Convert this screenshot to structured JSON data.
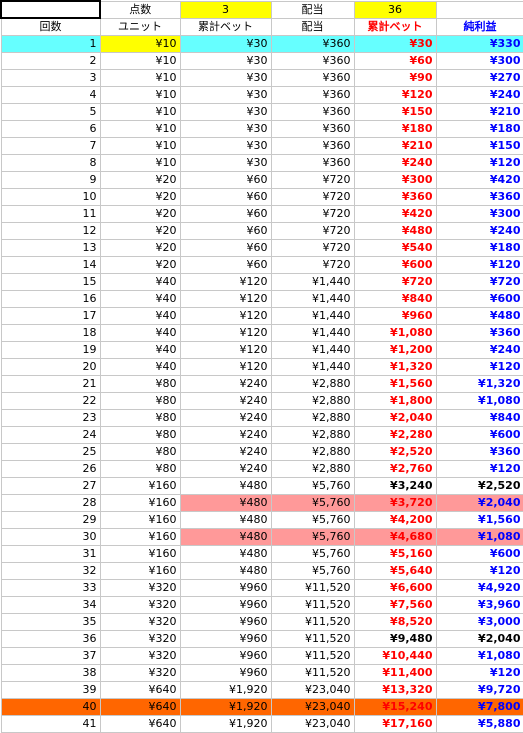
{
  "top": {
    "label_points": "点数",
    "points": "3",
    "label_payout": "配当",
    "payout": "36"
  },
  "headers": [
    "回数",
    "ユニット",
    "累計ベット",
    "配当",
    "累計ベット",
    "純利益"
  ],
  "colors": {
    "yellow": "#ffff00",
    "cyan": "#66ffff",
    "pink": "#ff9999",
    "orange": "#ff6600",
    "red": "#ff0000",
    "blue": "#0000ff"
  },
  "rows": [
    {
      "n": "1",
      "unit": "¥10",
      "bet": "¥30",
      "pay": "¥360",
      "cum": "¥30",
      "net": "¥330",
      "hl": "cyan",
      "net_color": "blue",
      "cum_color": "red"
    },
    {
      "n": "2",
      "unit": "¥10",
      "bet": "¥30",
      "pay": "¥360",
      "cum": "¥60",
      "net": "¥300",
      "hl": "",
      "net_color": "blue",
      "cum_color": "red"
    },
    {
      "n": "3",
      "unit": "¥10",
      "bet": "¥30",
      "pay": "¥360",
      "cum": "¥90",
      "net": "¥270",
      "hl": "",
      "net_color": "blue",
      "cum_color": "red"
    },
    {
      "n": "4",
      "unit": "¥10",
      "bet": "¥30",
      "pay": "¥360",
      "cum": "¥120",
      "net": "¥240",
      "hl": "",
      "net_color": "blue",
      "cum_color": "red"
    },
    {
      "n": "5",
      "unit": "¥10",
      "bet": "¥30",
      "pay": "¥360",
      "cum": "¥150",
      "net": "¥210",
      "hl": "",
      "net_color": "blue",
      "cum_color": "red"
    },
    {
      "n": "6",
      "unit": "¥10",
      "bet": "¥30",
      "pay": "¥360",
      "cum": "¥180",
      "net": "¥180",
      "hl": "",
      "net_color": "blue",
      "cum_color": "red"
    },
    {
      "n": "7",
      "unit": "¥10",
      "bet": "¥30",
      "pay": "¥360",
      "cum": "¥210",
      "net": "¥150",
      "hl": "",
      "net_color": "blue",
      "cum_color": "red"
    },
    {
      "n": "8",
      "unit": "¥10",
      "bet": "¥30",
      "pay": "¥360",
      "cum": "¥240",
      "net": "¥120",
      "hl": "",
      "net_color": "blue",
      "cum_color": "red"
    },
    {
      "n": "9",
      "unit": "¥20",
      "bet": "¥60",
      "pay": "¥720",
      "cum": "¥300",
      "net": "¥420",
      "hl": "",
      "net_color": "blue",
      "cum_color": "red"
    },
    {
      "n": "10",
      "unit": "¥20",
      "bet": "¥60",
      "pay": "¥720",
      "cum": "¥360",
      "net": "¥360",
      "hl": "",
      "net_color": "blue",
      "cum_color": "red"
    },
    {
      "n": "11",
      "unit": "¥20",
      "bet": "¥60",
      "pay": "¥720",
      "cum": "¥420",
      "net": "¥300",
      "hl": "",
      "net_color": "blue",
      "cum_color": "red"
    },
    {
      "n": "12",
      "unit": "¥20",
      "bet": "¥60",
      "pay": "¥720",
      "cum": "¥480",
      "net": "¥240",
      "hl": "",
      "net_color": "blue",
      "cum_color": "red"
    },
    {
      "n": "13",
      "unit": "¥20",
      "bet": "¥60",
      "pay": "¥720",
      "cum": "¥540",
      "net": "¥180",
      "hl": "",
      "net_color": "blue",
      "cum_color": "red"
    },
    {
      "n": "14",
      "unit": "¥20",
      "bet": "¥60",
      "pay": "¥720",
      "cum": "¥600",
      "net": "¥120",
      "hl": "",
      "net_color": "blue",
      "cum_color": "red"
    },
    {
      "n": "15",
      "unit": "¥40",
      "bet": "¥120",
      "pay": "¥1,440",
      "cum": "¥720",
      "net": "¥720",
      "hl": "",
      "net_color": "blue",
      "cum_color": "red"
    },
    {
      "n": "16",
      "unit": "¥40",
      "bet": "¥120",
      "pay": "¥1,440",
      "cum": "¥840",
      "net": "¥600",
      "hl": "",
      "net_color": "blue",
      "cum_color": "red"
    },
    {
      "n": "17",
      "unit": "¥40",
      "bet": "¥120",
      "pay": "¥1,440",
      "cum": "¥960",
      "net": "¥480",
      "hl": "",
      "net_color": "blue",
      "cum_color": "red"
    },
    {
      "n": "18",
      "unit": "¥40",
      "bet": "¥120",
      "pay": "¥1,440",
      "cum": "¥1,080",
      "net": "¥360",
      "hl": "",
      "net_color": "blue",
      "cum_color": "red"
    },
    {
      "n": "19",
      "unit": "¥40",
      "bet": "¥120",
      "pay": "¥1,440",
      "cum": "¥1,200",
      "net": "¥240",
      "hl": "",
      "net_color": "blue",
      "cum_color": "red"
    },
    {
      "n": "20",
      "unit": "¥40",
      "bet": "¥120",
      "pay": "¥1,440",
      "cum": "¥1,320",
      "net": "¥120",
      "hl": "",
      "net_color": "blue",
      "cum_color": "red"
    },
    {
      "n": "21",
      "unit": "¥80",
      "bet": "¥240",
      "pay": "¥2,880",
      "cum": "¥1,560",
      "net": "¥1,320",
      "hl": "",
      "net_color": "blue",
      "cum_color": "red"
    },
    {
      "n": "22",
      "unit": "¥80",
      "bet": "¥240",
      "pay": "¥2,880",
      "cum": "¥1,800",
      "net": "¥1,080",
      "hl": "",
      "net_color": "blue",
      "cum_color": "red"
    },
    {
      "n": "23",
      "unit": "¥80",
      "bet": "¥240",
      "pay": "¥2,880",
      "cum": "¥2,040",
      "net": "¥840",
      "hl": "",
      "net_color": "blue",
      "cum_color": "red"
    },
    {
      "n": "24",
      "unit": "¥80",
      "bet": "¥240",
      "pay": "¥2,880",
      "cum": "¥2,280",
      "net": "¥600",
      "hl": "",
      "net_color": "blue",
      "cum_color": "red"
    },
    {
      "n": "25",
      "unit": "¥80",
      "bet": "¥240",
      "pay": "¥2,880",
      "cum": "¥2,520",
      "net": "¥360",
      "hl": "",
      "net_color": "blue",
      "cum_color": "red"
    },
    {
      "n": "26",
      "unit": "¥80",
      "bet": "¥240",
      "pay": "¥2,880",
      "cum": "¥2,760",
      "net": "¥120",
      "hl": "",
      "net_color": "blue",
      "cum_color": "red"
    },
    {
      "n": "27",
      "unit": "¥160",
      "bet": "¥480",
      "pay": "¥5,760",
      "cum": "¥3,240",
      "net": "¥2,520",
      "hl": "",
      "net_color": "blk",
      "cum_color": "blk"
    },
    {
      "n": "28",
      "unit": "¥160",
      "bet": "¥480",
      "pay": "¥5,760",
      "cum": "¥3,720",
      "net": "¥2,040",
      "hl": "pink",
      "net_color": "blue",
      "cum_color": "red"
    },
    {
      "n": "29",
      "unit": "¥160",
      "bet": "¥480",
      "pay": "¥5,760",
      "cum": "¥4,200",
      "net": "¥1,560",
      "hl": "",
      "net_color": "blue",
      "cum_color": "red"
    },
    {
      "n": "30",
      "unit": "¥160",
      "bet": "¥480",
      "pay": "¥5,760",
      "cum": "¥4,680",
      "net": "¥1,080",
      "hl": "pink",
      "net_color": "blue",
      "cum_color": "red"
    },
    {
      "n": "31",
      "unit": "¥160",
      "bet": "¥480",
      "pay": "¥5,760",
      "cum": "¥5,160",
      "net": "¥600",
      "hl": "",
      "net_color": "blue",
      "cum_color": "red"
    },
    {
      "n": "32",
      "unit": "¥160",
      "bet": "¥480",
      "pay": "¥5,760",
      "cum": "¥5,640",
      "net": "¥120",
      "hl": "",
      "net_color": "blue",
      "cum_color": "red"
    },
    {
      "n": "33",
      "unit": "¥320",
      "bet": "¥960",
      "pay": "¥11,520",
      "cum": "¥6,600",
      "net": "¥4,920",
      "hl": "",
      "net_color": "blue",
      "cum_color": "red"
    },
    {
      "n": "34",
      "unit": "¥320",
      "bet": "¥960",
      "pay": "¥11,520",
      "cum": "¥7,560",
      "net": "¥3,960",
      "hl": "",
      "net_color": "blue",
      "cum_color": "red"
    },
    {
      "n": "35",
      "unit": "¥320",
      "bet": "¥960",
      "pay": "¥11,520",
      "cum": "¥8,520",
      "net": "¥3,000",
      "hl": "",
      "net_color": "blue",
      "cum_color": "red"
    },
    {
      "n": "36",
      "unit": "¥320",
      "bet": "¥960",
      "pay": "¥11,520",
      "cum": "¥9,480",
      "net": "¥2,040",
      "hl": "",
      "net_color": "blk",
      "cum_color": "blk"
    },
    {
      "n": "37",
      "unit": "¥320",
      "bet": "¥960",
      "pay": "¥11,520",
      "cum": "¥10,440",
      "net": "¥1,080",
      "hl": "",
      "net_color": "blue",
      "cum_color": "red"
    },
    {
      "n": "38",
      "unit": "¥320",
      "bet": "¥960",
      "pay": "¥11,520",
      "cum": "¥11,400",
      "net": "¥120",
      "hl": "",
      "net_color": "blue",
      "cum_color": "red"
    },
    {
      "n": "39",
      "unit": "¥640",
      "bet": "¥1,920",
      "pay": "¥23,040",
      "cum": "¥13,320",
      "net": "¥9,720",
      "hl": "",
      "net_color": "blue",
      "cum_color": "red"
    },
    {
      "n": "40",
      "unit": "¥640",
      "bet": "¥1,920",
      "pay": "¥23,040",
      "cum": "¥15,240",
      "net": "¥7,800",
      "hl": "orange",
      "net_color": "blue",
      "cum_color": "red"
    },
    {
      "n": "41",
      "unit": "¥640",
      "bet": "¥1,920",
      "pay": "¥23,040",
      "cum": "¥17,160",
      "net": "¥5,880",
      "hl": "",
      "net_color": "blue",
      "cum_color": "red"
    }
  ]
}
